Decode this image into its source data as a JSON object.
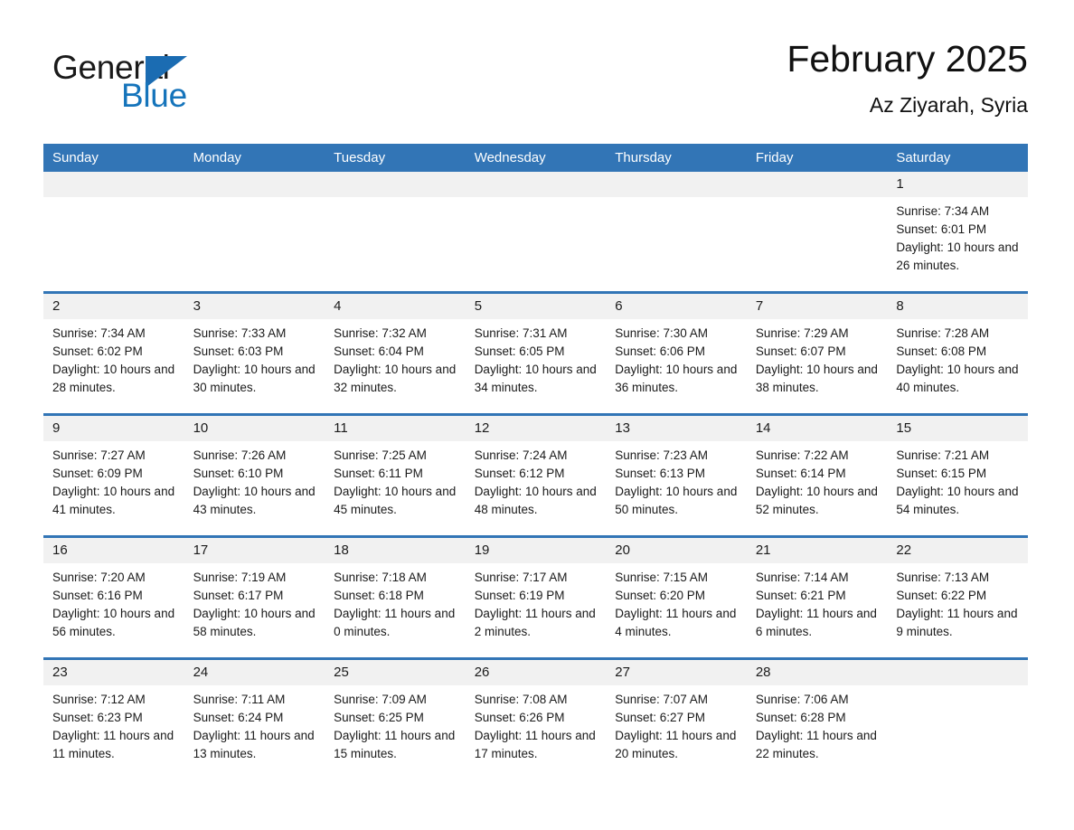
{
  "brand": {
    "word_one": "General",
    "word_two": "Blue",
    "triangle_icon": "triangle-logo-icon",
    "accent_color": "#1b6cb2"
  },
  "header": {
    "title": "February 2025",
    "subtitle": "Az Ziyarah, Syria"
  },
  "theme": {
    "header_blue": "#3275b6",
    "daynum_band": "#f1f1f1",
    "cell_background": "#ffffff"
  },
  "weekday_headers": [
    "Sunday",
    "Monday",
    "Tuesday",
    "Wednesday",
    "Thursday",
    "Friday",
    "Saturday"
  ],
  "weeks": [
    [
      {
        "day": "",
        "lines": []
      },
      {
        "day": "",
        "lines": []
      },
      {
        "day": "",
        "lines": []
      },
      {
        "day": "",
        "lines": []
      },
      {
        "day": "",
        "lines": []
      },
      {
        "day": "",
        "lines": []
      },
      {
        "day": "1",
        "lines": [
          "Sunrise: 7:34 AM",
          "Sunset: 6:01 PM",
          "Daylight: 10 hours and 26 minutes."
        ]
      }
    ],
    [
      {
        "day": "2",
        "lines": [
          "Sunrise: 7:34 AM",
          "Sunset: 6:02 PM",
          "Daylight: 10 hours and 28 minutes."
        ]
      },
      {
        "day": "3",
        "lines": [
          "Sunrise: 7:33 AM",
          "Sunset: 6:03 PM",
          "Daylight: 10 hours and 30 minutes."
        ]
      },
      {
        "day": "4",
        "lines": [
          "Sunrise: 7:32 AM",
          "Sunset: 6:04 PM",
          "Daylight: 10 hours and 32 minutes."
        ]
      },
      {
        "day": "5",
        "lines": [
          "Sunrise: 7:31 AM",
          "Sunset: 6:05 PM",
          "Daylight: 10 hours and 34 minutes."
        ]
      },
      {
        "day": "6",
        "lines": [
          "Sunrise: 7:30 AM",
          "Sunset: 6:06 PM",
          "Daylight: 10 hours and 36 minutes."
        ]
      },
      {
        "day": "7",
        "lines": [
          "Sunrise: 7:29 AM",
          "Sunset: 6:07 PM",
          "Daylight: 10 hours and 38 minutes."
        ]
      },
      {
        "day": "8",
        "lines": [
          "Sunrise: 7:28 AM",
          "Sunset: 6:08 PM",
          "Daylight: 10 hours and 40 minutes."
        ]
      }
    ],
    [
      {
        "day": "9",
        "lines": [
          "Sunrise: 7:27 AM",
          "Sunset: 6:09 PM",
          "Daylight: 10 hours and 41 minutes."
        ]
      },
      {
        "day": "10",
        "lines": [
          "Sunrise: 7:26 AM",
          "Sunset: 6:10 PM",
          "Daylight: 10 hours and 43 minutes."
        ]
      },
      {
        "day": "11",
        "lines": [
          "Sunrise: 7:25 AM",
          "Sunset: 6:11 PM",
          "Daylight: 10 hours and 45 minutes."
        ]
      },
      {
        "day": "12",
        "lines": [
          "Sunrise: 7:24 AM",
          "Sunset: 6:12 PM",
          "Daylight: 10 hours and 48 minutes."
        ]
      },
      {
        "day": "13",
        "lines": [
          "Sunrise: 7:23 AM",
          "Sunset: 6:13 PM",
          "Daylight: 10 hours and 50 minutes."
        ]
      },
      {
        "day": "14",
        "lines": [
          "Sunrise: 7:22 AM",
          "Sunset: 6:14 PM",
          "Daylight: 10 hours and 52 minutes."
        ]
      },
      {
        "day": "15",
        "lines": [
          "Sunrise: 7:21 AM",
          "Sunset: 6:15 PM",
          "Daylight: 10 hours and 54 minutes."
        ]
      }
    ],
    [
      {
        "day": "16",
        "lines": [
          "Sunrise: 7:20 AM",
          "Sunset: 6:16 PM",
          "Daylight: 10 hours and 56 minutes."
        ]
      },
      {
        "day": "17",
        "lines": [
          "Sunrise: 7:19 AM",
          "Sunset: 6:17 PM",
          "Daylight: 10 hours and 58 minutes."
        ]
      },
      {
        "day": "18",
        "lines": [
          "Sunrise: 7:18 AM",
          "Sunset: 6:18 PM",
          "Daylight: 11 hours and 0 minutes."
        ]
      },
      {
        "day": "19",
        "lines": [
          "Sunrise: 7:17 AM",
          "Sunset: 6:19 PM",
          "Daylight: 11 hours and 2 minutes."
        ]
      },
      {
        "day": "20",
        "lines": [
          "Sunrise: 7:15 AM",
          "Sunset: 6:20 PM",
          "Daylight: 11 hours and 4 minutes."
        ]
      },
      {
        "day": "21",
        "lines": [
          "Sunrise: 7:14 AM",
          "Sunset: 6:21 PM",
          "Daylight: 11 hours and 6 minutes."
        ]
      },
      {
        "day": "22",
        "lines": [
          "Sunrise: 7:13 AM",
          "Sunset: 6:22 PM",
          "Daylight: 11 hours and 9 minutes."
        ]
      }
    ],
    [
      {
        "day": "23",
        "lines": [
          "Sunrise: 7:12 AM",
          "Sunset: 6:23 PM",
          "Daylight: 11 hours and 11 minutes."
        ]
      },
      {
        "day": "24",
        "lines": [
          "Sunrise: 7:11 AM",
          "Sunset: 6:24 PM",
          "Daylight: 11 hours and 13 minutes."
        ]
      },
      {
        "day": "25",
        "lines": [
          "Sunrise: 7:09 AM",
          "Sunset: 6:25 PM",
          "Daylight: 11 hours and 15 minutes."
        ]
      },
      {
        "day": "26",
        "lines": [
          "Sunrise: 7:08 AM",
          "Sunset: 6:26 PM",
          "Daylight: 11 hours and 17 minutes."
        ]
      },
      {
        "day": "27",
        "lines": [
          "Sunrise: 7:07 AM",
          "Sunset: 6:27 PM",
          "Daylight: 11 hours and 20 minutes."
        ]
      },
      {
        "day": "28",
        "lines": [
          "Sunrise: 7:06 AM",
          "Sunset: 6:28 PM",
          "Daylight: 11 hours and 22 minutes."
        ]
      },
      {
        "day": "",
        "lines": []
      }
    ]
  ]
}
